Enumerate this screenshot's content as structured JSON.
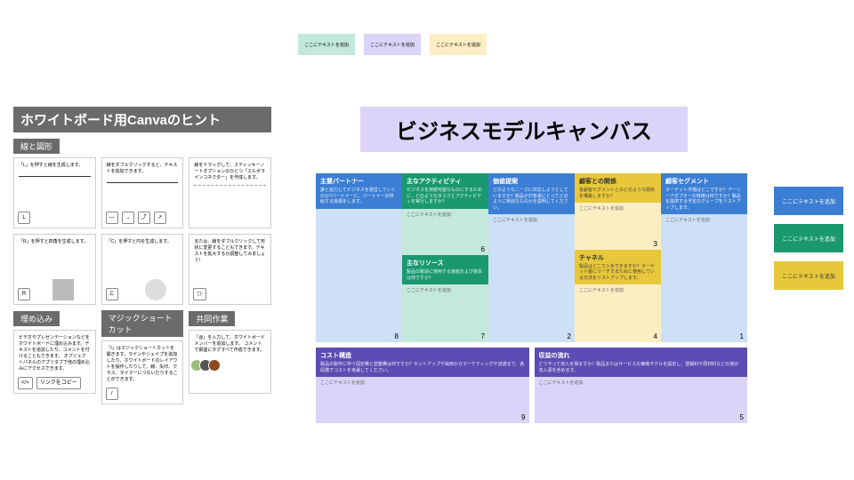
{
  "top_stickies": {
    "label": "ここにテキストを追加"
  },
  "left": {
    "title": "ホワイトボード用Canvaのヒント",
    "section_lines": "線と図形",
    "section_embed": "埋め込み",
    "section_magic": "マジックショートカット",
    "section_collab": "共同作業",
    "card_L": "「L」を押すと線を生成します。",
    "card_dbl": "線をダブルクリックすると、テキストを追加できます。",
    "card_drag": "線をドラッグして、スティッキーノートオプションのひとつ「エルボラインコネクター」を作成します。",
    "card_R": "「R」を押すと四角を生成します。",
    "card_C": "「C」を押すと円を生成します。",
    "card_magic2": "または、線をダブルクリックして形状に変更することもできます。テキストを拡大するか調整してみましょう！",
    "card_embed": "ビデオやプレゼンテーションなどをホワイトボードに埋め込みます。テキストを追加したり、コメントを付けることもできます。\nオブジェクトパネルのアプリタブで他の埋め込みにアクセスできます。",
    "card_link": "リンクをコピー",
    "card_slash": "「/」はマジックショートカットを開きます。ラインやシェイプを追加したり、ホワイトボードのレイアウトを操作したりして、線、矢印、クラス、タイマーにつないだりすることができます。",
    "card_collab": "「@」を入力して、ホワイトボードメンバーを追加します。\nコメントで即座にタグすべて作成できます。"
  },
  "main_title": "ビジネスモデルキャンバス",
  "bmc": {
    "partners": {
      "title": "主要パートナー",
      "desc": "誰と協力してビジネスを運営していくのか?パートナーに、パートナーが供給する資源をします。",
      "num": "8"
    },
    "activities": {
      "title": "主なアクティビティ",
      "desc": "ビジネスを持続可能なものにするために、どのようなタスクとアクティビティを実行しますか？",
      "num": "6"
    },
    "resources": {
      "title": "主なリソース",
      "desc": "製品の製造に使用する資産および資本は何ですか？",
      "num": "7"
    },
    "value": {
      "title": "価値提案",
      "desc": "どのようなニーズに対応しようとしていますか？製品が対象者にとってどのように特別なものかを説明してください。",
      "num": "2"
    },
    "relations": {
      "title": "顧客との関係",
      "desc": "各顧客セグメントとのどのような関係を構築しますか？",
      "num": "3"
    },
    "channels": {
      "title": "チャネル",
      "desc": "製品はどこで入手できますか？ターゲット層にリーチするために使用している方法をリストアップします。",
      "num": "4"
    },
    "segments": {
      "title": "顧客セグメント",
      "desc": "ターゲット市場はどこですか？アーリーアダプターの特徴は何ですか？製品を提供する予定のグループをリストアップします。",
      "num": "1"
    },
    "cost": {
      "title": "コスト構造",
      "desc": "製品の製作に伴う固定費と変動費は何ですか？セットアップや採用からマーケティングや流通まで、各段階でコストを考慮してください。",
      "num": "9"
    },
    "revenue": {
      "title": "収益の流れ",
      "desc": "どうやって収入を得ますか？製品またはサービスの価格モデルを設定し、登録料や原材料などの他の収入源を含めます。",
      "num": "5"
    },
    "add": "ここにテキストを追加"
  },
  "right_label": "ここにテキストを追加"
}
